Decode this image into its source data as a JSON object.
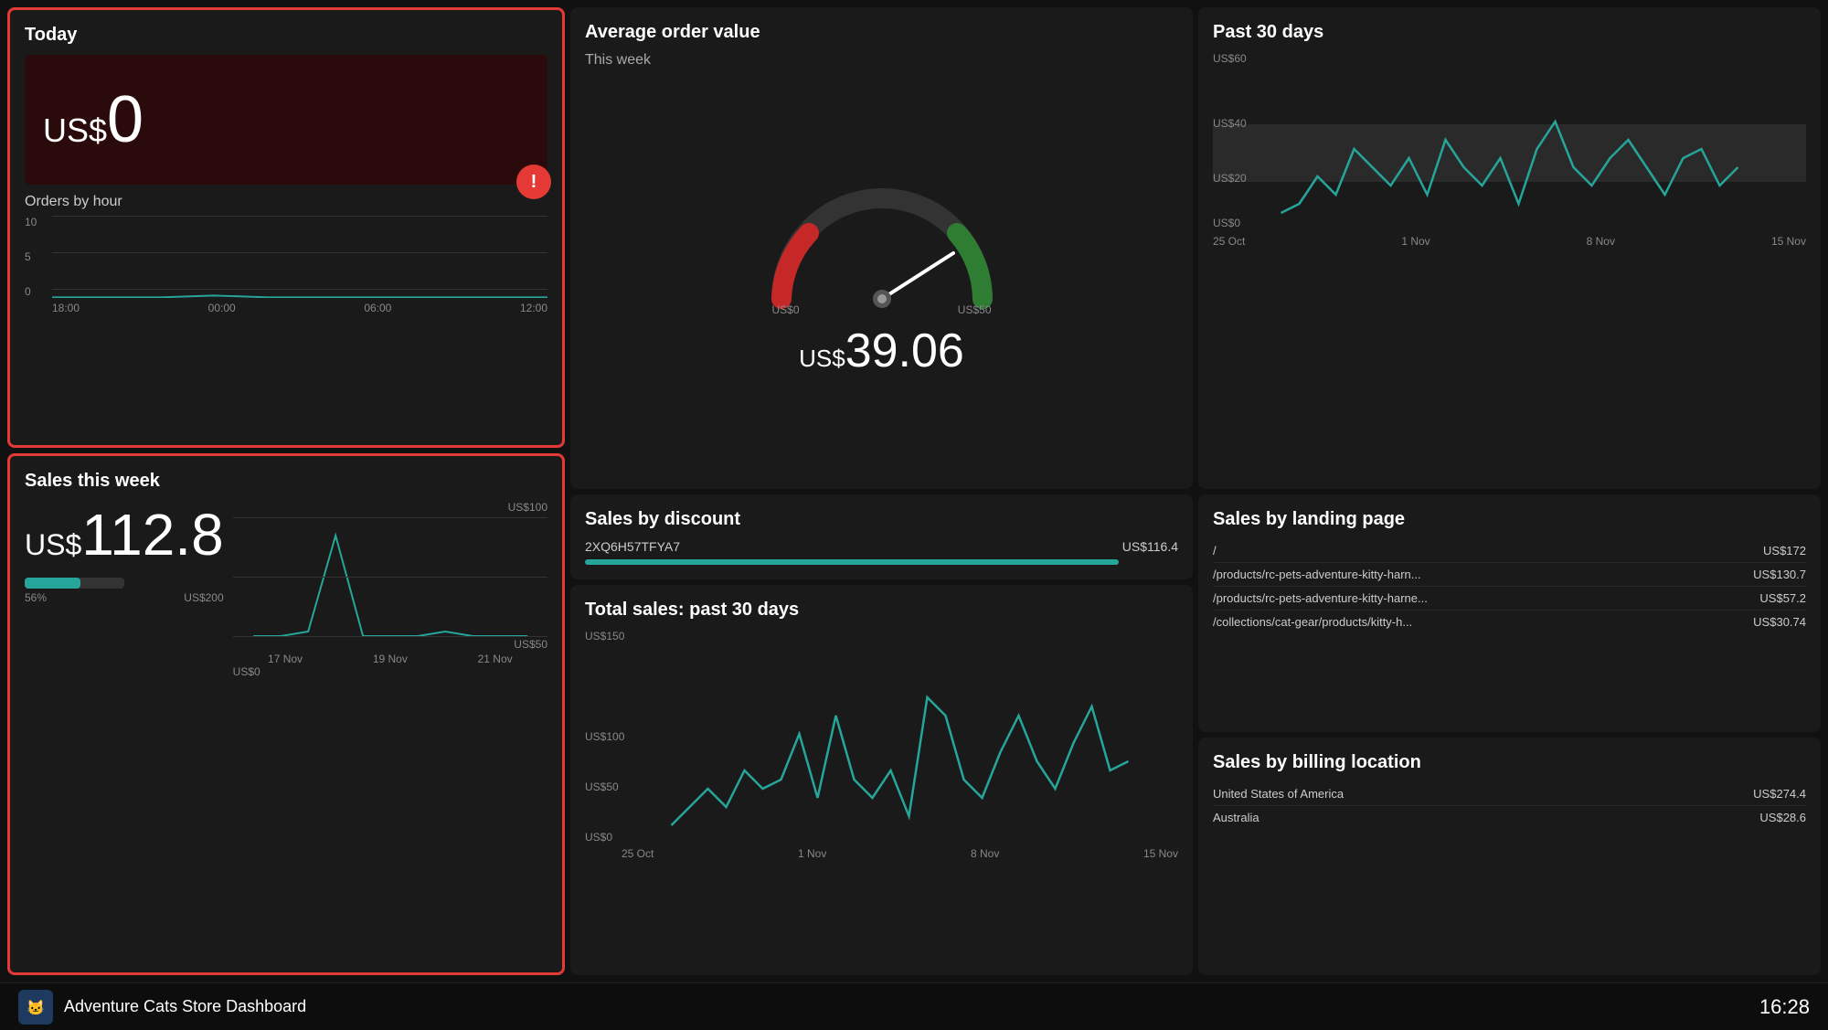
{
  "footer": {
    "title": "Adventure Cats Store Dashboard",
    "time": "16:28",
    "logo": "🐱"
  },
  "today": {
    "title": "Today",
    "value": "0",
    "currency": "US$"
  },
  "orders_by_hour": {
    "title": "Orders by hour",
    "y_labels": [
      "10",
      "5",
      "0"
    ],
    "x_labels": [
      "18:00",
      "00:00",
      "06:00",
      "12:00"
    ]
  },
  "sales_week": {
    "title": "Sales this week",
    "value": "112.8",
    "currency": "US$",
    "progress_pct": 56,
    "progress_label": "56%",
    "progress_target": "US$200",
    "chart_y_labels": [
      "US$100",
      "US$50",
      "US$0"
    ],
    "chart_x_labels": [
      "17 Nov",
      "19 Nov",
      "21 Nov"
    ]
  },
  "avg_order": {
    "title": "Average order value",
    "subtitle": "This week",
    "value": "39.06",
    "currency": "US$",
    "gauge_min": "US$0",
    "gauge_max": "US$50"
  },
  "past30": {
    "title": "Past 30 days",
    "y_labels": [
      "US$60",
      "US$40",
      "US$20",
      "US$0"
    ],
    "x_labels": [
      "25 Oct",
      "1 Nov",
      "8 Nov",
      "15 Nov"
    ]
  },
  "sales_discount": {
    "title": "Sales by discount",
    "items": [
      {
        "code": "2XQ6H57TFYA7",
        "value": "US$116.4",
        "pct": 90
      }
    ]
  },
  "total_sales": {
    "title": "Total sales: past 30 days",
    "y_labels": [
      "US$150",
      "US$100",
      "US$50",
      "US$0"
    ],
    "x_labels": [
      "25 Oct",
      "1 Nov",
      "8 Nov",
      "15 Nov"
    ]
  },
  "sales_landing": {
    "title": "Sales by landing page",
    "items": [
      {
        "label": "/",
        "value": "US$172"
      },
      {
        "label": "/products/rc-pets-adventure-kitty-harn...",
        "value": "US$130.7"
      },
      {
        "label": "/products/rc-pets-adventure-kitty-harne...",
        "value": "US$57.2"
      },
      {
        "label": "/collections/cat-gear/products/kitty-h...",
        "value": "US$30.74"
      }
    ]
  },
  "sales_billing": {
    "title": "Sales by billing location",
    "items": [
      {
        "label": "United States of America",
        "value": "US$274.4"
      },
      {
        "label": "Australia",
        "value": "US$28.6"
      }
    ]
  }
}
